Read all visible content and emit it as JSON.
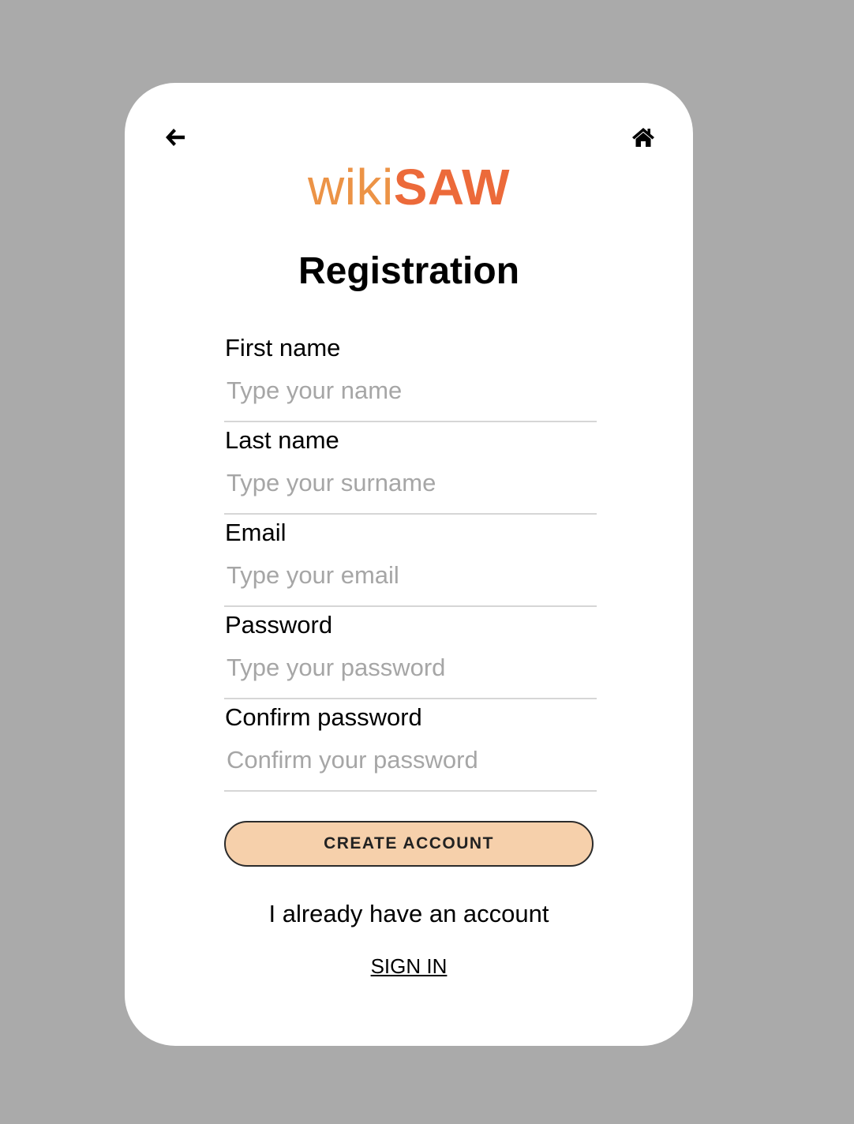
{
  "nav": {
    "back_icon": "arrow-left-icon",
    "home_icon": "home-icon"
  },
  "logo": {
    "light": "wiki",
    "bold": "SAW"
  },
  "title": "Registration",
  "fields": [
    {
      "label": "First name",
      "placeholder": "Type your name",
      "value": ""
    },
    {
      "label": "Last name",
      "placeholder": "Type your surname",
      "value": ""
    },
    {
      "label": "Email",
      "placeholder": "Type your email",
      "value": ""
    },
    {
      "label": "Password",
      "placeholder": "Type your password",
      "value": ""
    },
    {
      "label": "Confirm password",
      "placeholder": "Confirm your password",
      "value": ""
    }
  ],
  "create_button": "CREATE ACCOUNT",
  "already_text": "I already have an account",
  "signin_link": "SIGN IN",
  "colors": {
    "background": "#aaaaaa",
    "card": "#ffffff",
    "logo_light": "#ec9346",
    "logo_bold": "#ec6a3a",
    "button_fill": "#f6d0ab",
    "button_border": "#2b2b2b",
    "placeholder": "#a6a6a6",
    "divider": "#d6d6d6"
  }
}
